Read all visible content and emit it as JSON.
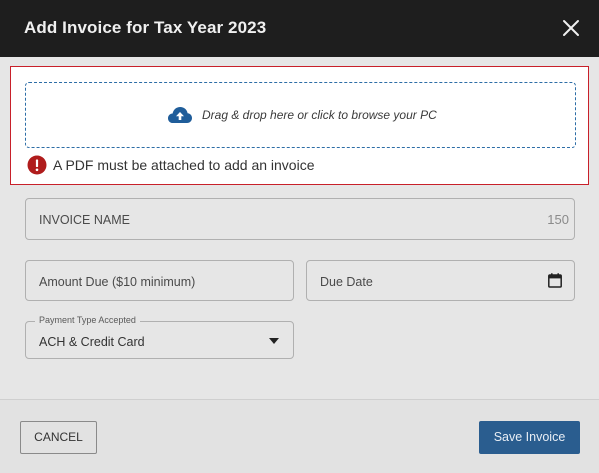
{
  "dialog": {
    "title": "Add Invoice for Tax Year 2023",
    "close_icon": "close-icon"
  },
  "upload": {
    "dropzone_text": "Drag & drop here or click to browse your PC",
    "upload_icon": "cloud-upload-icon",
    "error_icon": "error-icon",
    "error_text": "A PDF must be attached to add an invoice",
    "colors": {
      "error_border": "#c8202a",
      "dropzone_border": "#2d6da6",
      "icon": "#1f5d9a",
      "error_icon": "#b01c1c"
    }
  },
  "form": {
    "invoice_name": {
      "placeholder": "INVOICE NAME",
      "char_limit": "150"
    },
    "amount_due": {
      "placeholder": "Amount Due ($10 minimum)"
    },
    "due_date": {
      "placeholder": "Due Date",
      "icon": "calendar-icon"
    },
    "payment_type": {
      "legend": "Payment Type Accepted",
      "value": "ACH & Credit Card",
      "icon": "caret-down-icon"
    }
  },
  "footer": {
    "cancel_label": "CANCEL",
    "save_label": "Save Invoice",
    "colors": {
      "save_bg": "#2a5d8f"
    }
  }
}
